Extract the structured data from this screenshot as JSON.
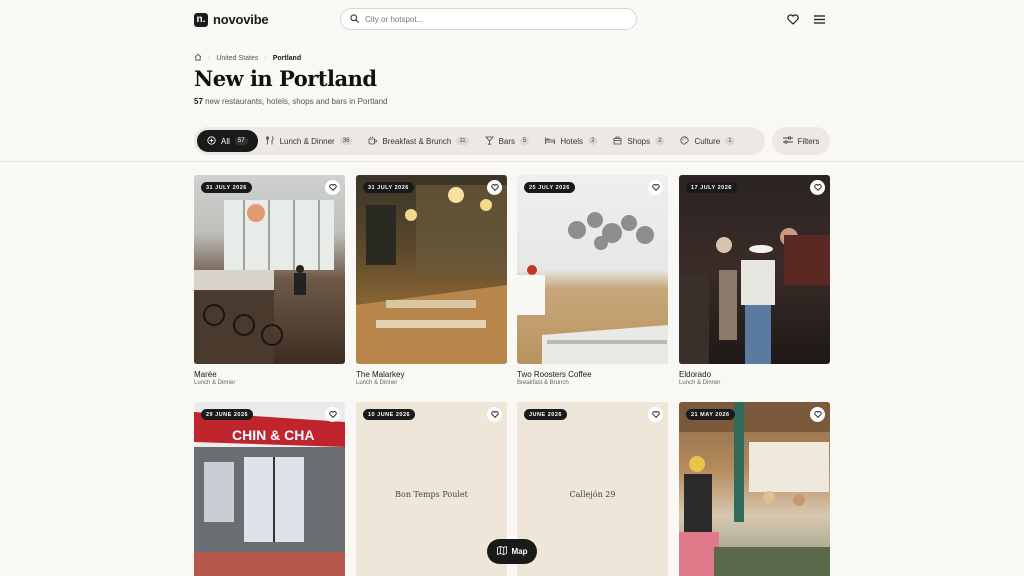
{
  "brand": {
    "name": "novovibe",
    "mark": "n."
  },
  "search": {
    "placeholder": "City or hotspot..."
  },
  "header": {
    "icons": [
      "heart-icon",
      "menu-icon"
    ]
  },
  "breadcrumb": {
    "items": [
      "United States",
      "Portland"
    ]
  },
  "page": {
    "title": "New in Portland",
    "count": "57",
    "subtitle": "new restaurants, hotels, shops and bars in Portland"
  },
  "filters": {
    "chips": [
      {
        "label": "All",
        "count": "57",
        "icon": "plus-circle-icon"
      },
      {
        "label": "Lunch & Dinner",
        "count": "36",
        "icon": "utensils-icon"
      },
      {
        "label": "Breakfast & Brunch",
        "count": "11",
        "icon": "coffee-cup-icon"
      },
      {
        "label": "Bars",
        "count": "5",
        "icon": "cocktail-icon"
      },
      {
        "label": "Hotels",
        "count": "2",
        "icon": "bed-icon"
      },
      {
        "label": "Shops",
        "count": "2",
        "icon": "shop-bag-icon"
      },
      {
        "label": "Culture",
        "count": "1",
        "icon": "palette-icon"
      }
    ],
    "filters_label": "Filters"
  },
  "cards": [
    {
      "date": "31 July 2026",
      "name": "Marée",
      "category": "Lunch & Dinner"
    },
    {
      "date": "31 July 2026",
      "name": "The Malarkey",
      "category": "Lunch & Dinner"
    },
    {
      "date": "25 July 2026",
      "name": "Two Roosters Coffee",
      "category": "Breakfast & Brunch"
    },
    {
      "date": "17 July 2026",
      "name": "Eldorado",
      "category": "Lunch & Dinner"
    },
    {
      "date": "29 June 2026",
      "sign": "CHIN & CHA"
    },
    {
      "date": "10 June 2026",
      "placeholder": "Bon Temps Poulet"
    },
    {
      "date": "June 2026",
      "placeholder": "Callejón 29"
    },
    {
      "date": "21 May 2026"
    }
  ],
  "map": {
    "label": "Map"
  },
  "colors": {
    "accent": "#1a1a1a",
    "background": "#faf8f5",
    "chip_bg": "#ece9e4",
    "placeholder_bg": "#efe6da"
  }
}
